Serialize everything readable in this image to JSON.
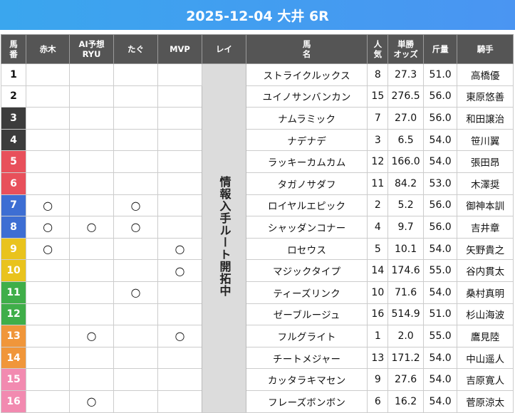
{
  "title": "2025-12-04 大井 6R",
  "headers": {
    "num": "馬\n番",
    "akagi": "赤木",
    "ai": "AI予想\nRYU",
    "tagu": "たぐ",
    "mvp": "MVP",
    "rei": "レイ",
    "horse": "馬\n名",
    "pop": "人\n気",
    "odds": "単勝\nオッズ",
    "weight": "斤量",
    "jockey": "騎手"
  },
  "rei_text": "情報入手ルート開拓中",
  "mark_symbol": "○",
  "frame_colors": {
    "1": "#ffffff",
    "2": "#ffffff",
    "3": "#3c3c3c",
    "4": "#3c3c3c",
    "5": "#e8505b",
    "6": "#e8505b",
    "7": "#3d6ed3",
    "8": "#3d6ed3",
    "9": "#e9c31d",
    "10": "#e9c31d",
    "11": "#3fae49",
    "12": "#3fae49",
    "13": "#f0963a",
    "14": "#f0963a",
    "15": "#f28ab0",
    "16": "#f28ab0"
  },
  "rows": [
    {
      "num": "1",
      "akagi": "",
      "ai": "",
      "tagu": "",
      "mvp": "",
      "horse": "ストライクルックス",
      "pop": "8",
      "odds": "27.3",
      "weight": "51.0",
      "jockey": "高橋優"
    },
    {
      "num": "2",
      "akagi": "",
      "ai": "",
      "tagu": "",
      "mvp": "",
      "horse": "ユイノサンバンカン",
      "pop": "15",
      "odds": "276.5",
      "weight": "56.0",
      "jockey": "東原悠善"
    },
    {
      "num": "3",
      "akagi": "",
      "ai": "",
      "tagu": "",
      "mvp": "",
      "horse": "ナムラミック",
      "pop": "7",
      "odds": "27.0",
      "weight": "56.0",
      "jockey": "和田譲治"
    },
    {
      "num": "4",
      "akagi": "",
      "ai": "",
      "tagu": "",
      "mvp": "",
      "horse": "ナデナデ",
      "pop": "3",
      "odds": "6.5",
      "weight": "54.0",
      "jockey": "笹川翼"
    },
    {
      "num": "5",
      "akagi": "",
      "ai": "",
      "tagu": "",
      "mvp": "",
      "horse": "ラッキーカムカム",
      "pop": "12",
      "odds": "166.0",
      "weight": "54.0",
      "jockey": "張田昂"
    },
    {
      "num": "6",
      "akagi": "",
      "ai": "",
      "tagu": "",
      "mvp": "",
      "horse": "タガノサダフ",
      "pop": "11",
      "odds": "84.2",
      "weight": "53.0",
      "jockey": "木澤奨"
    },
    {
      "num": "7",
      "akagi": "○",
      "ai": "",
      "tagu": "○",
      "mvp": "",
      "horse": "ロイヤルエピック",
      "pop": "2",
      "odds": "5.2",
      "weight": "56.0",
      "jockey": "御神本訓"
    },
    {
      "num": "8",
      "akagi": "○",
      "ai": "○",
      "tagu": "○",
      "mvp": "",
      "horse": "シャッダンコナー",
      "pop": "4",
      "odds": "9.7",
      "weight": "56.0",
      "jockey": "吉井章"
    },
    {
      "num": "9",
      "akagi": "○",
      "ai": "",
      "tagu": "",
      "mvp": "○",
      "horse": "ロセウス",
      "pop": "5",
      "odds": "10.1",
      "weight": "54.0",
      "jockey": "矢野貴之"
    },
    {
      "num": "10",
      "akagi": "",
      "ai": "",
      "tagu": "",
      "mvp": "○",
      "horse": "マジックタイプ",
      "pop": "14",
      "odds": "174.6",
      "weight": "55.0",
      "jockey": "谷内貫太"
    },
    {
      "num": "11",
      "akagi": "",
      "ai": "",
      "tagu": "○",
      "mvp": "",
      "horse": "ティーズリンク",
      "pop": "10",
      "odds": "71.6",
      "weight": "54.0",
      "jockey": "桑村真明"
    },
    {
      "num": "12",
      "akagi": "",
      "ai": "",
      "tagu": "",
      "mvp": "",
      "horse": "ゼーブルージュ",
      "pop": "16",
      "odds": "514.9",
      "weight": "51.0",
      "jockey": "杉山海波"
    },
    {
      "num": "13",
      "akagi": "",
      "ai": "○",
      "tagu": "",
      "mvp": "○",
      "horse": "フルグライト",
      "pop": "1",
      "odds": "2.0",
      "weight": "55.0",
      "jockey": "鷹見陸"
    },
    {
      "num": "14",
      "akagi": "",
      "ai": "",
      "tagu": "",
      "mvp": "",
      "horse": "チートメジャー",
      "pop": "13",
      "odds": "171.2",
      "weight": "54.0",
      "jockey": "中山遥人"
    },
    {
      "num": "15",
      "akagi": "",
      "ai": "",
      "tagu": "",
      "mvp": "",
      "horse": "カッタラキマセン",
      "pop": "9",
      "odds": "27.6",
      "weight": "54.0",
      "jockey": "吉原寛人"
    },
    {
      "num": "16",
      "akagi": "",
      "ai": "○",
      "tagu": "",
      "mvp": "",
      "horse": "フレーズボンボン",
      "pop": "6",
      "odds": "16.2",
      "weight": "54.0",
      "jockey": "菅原涼太"
    }
  ]
}
